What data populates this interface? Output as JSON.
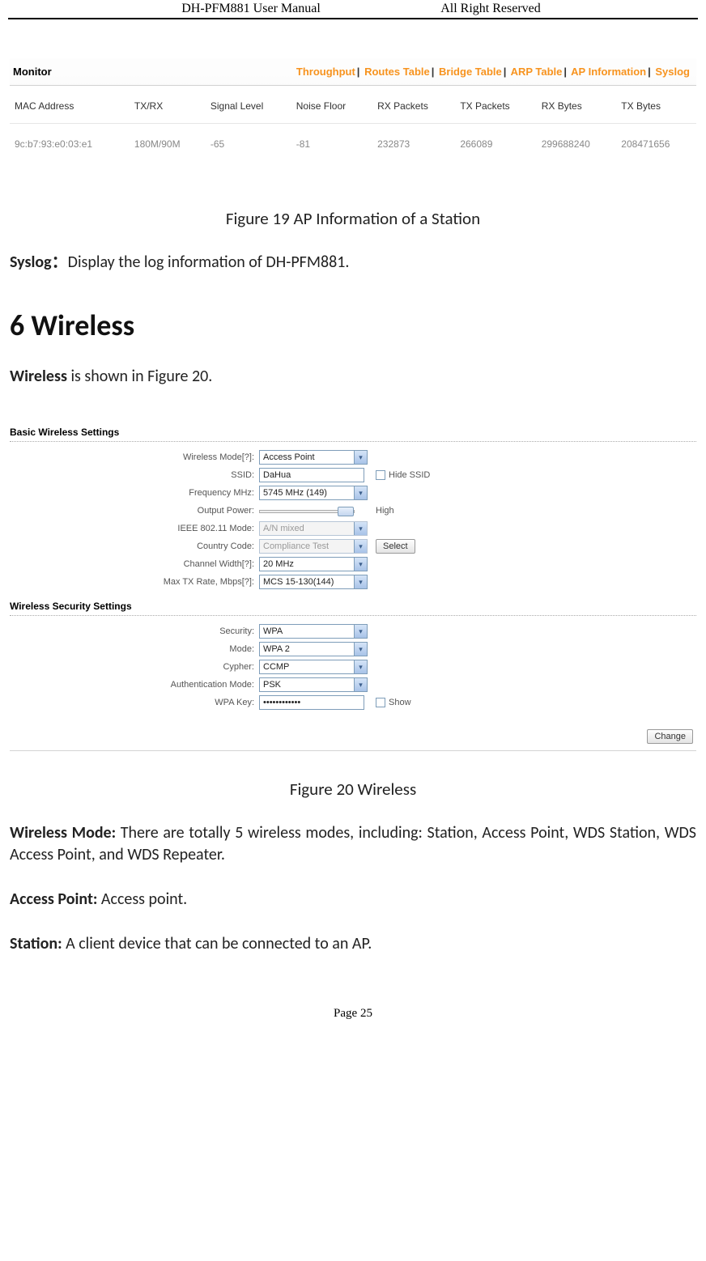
{
  "header": {
    "left": "DH-PFM881 User Manual",
    "right": "All Right Reserved"
  },
  "fig19": {
    "title": "Monitor",
    "tabs": [
      "Throughput",
      "Routes Table",
      "Bridge Table",
      "ARP Table",
      "AP Information",
      "Syslog"
    ],
    "columns": [
      "MAC Address",
      "TX/RX",
      "Signal Level",
      "Noise Floor",
      "RX Packets",
      "TX Packets",
      "RX Bytes",
      "TX Bytes"
    ],
    "row": [
      "9c:b7:93:e0:03:e1",
      "180M/90M",
      "-65",
      "-81",
      "232873",
      "266089",
      "299688240",
      "208471656"
    ],
    "caption": "Figure 19 AP Information of a Station"
  },
  "syslog": {
    "label": "Syslog：",
    "text": "Display the log information of DH-PFM881."
  },
  "section6": {
    "heading": "6  Wireless",
    "intro_bold": "Wireless",
    "intro_rest": " is shown in Figure 20."
  },
  "fig20": {
    "group1": "Basic Wireless Settings",
    "group2": "Wireless Security Settings",
    "rows": {
      "wireless_mode": {
        "label": "Wireless Mode[?]:",
        "value": "Access Point"
      },
      "ssid": {
        "label": "SSID:",
        "value": "DaHua",
        "extra": "Hide SSID"
      },
      "freq": {
        "label": "Frequency MHz:",
        "value": "5745 MHz (149)"
      },
      "power": {
        "label": "Output Power:",
        "extra": "High"
      },
      "ieee": {
        "label": "IEEE 802.11 Mode:",
        "value": "A/N mixed"
      },
      "country": {
        "label": "Country Code:",
        "value": "Compliance Test",
        "btn": "Select"
      },
      "chanwidth": {
        "label": "Channel Width[?]:",
        "value": "20 MHz"
      },
      "maxtx": {
        "label": "Max TX Rate, Mbps[?]:",
        "value": "MCS 15-130(144)"
      },
      "security": {
        "label": "Security:",
        "value": "WPA"
      },
      "mode": {
        "label": "Mode:",
        "value": "WPA 2"
      },
      "cypher": {
        "label": "Cypher:",
        "value": "CCMP"
      },
      "auth": {
        "label": "Authentication Mode:",
        "value": "PSK"
      },
      "wpakey": {
        "label": "WPA Key:",
        "value": "••••••••••••",
        "extra": "Show"
      }
    },
    "change_btn": "Change",
    "caption": "Figure 20 Wireless"
  },
  "body_text": {
    "wm_label": "Wireless Mode:",
    "wm_text": " There are totally 5 wireless modes, including: Station, Access Point, WDS Station, WDS Access Point, and WDS Repeater.",
    "ap_label": "Access Point:",
    "ap_text": " Access point.",
    "st_label": "Station:",
    "st_text": " A client device that can be connected to an AP."
  },
  "footer": "Page 25"
}
